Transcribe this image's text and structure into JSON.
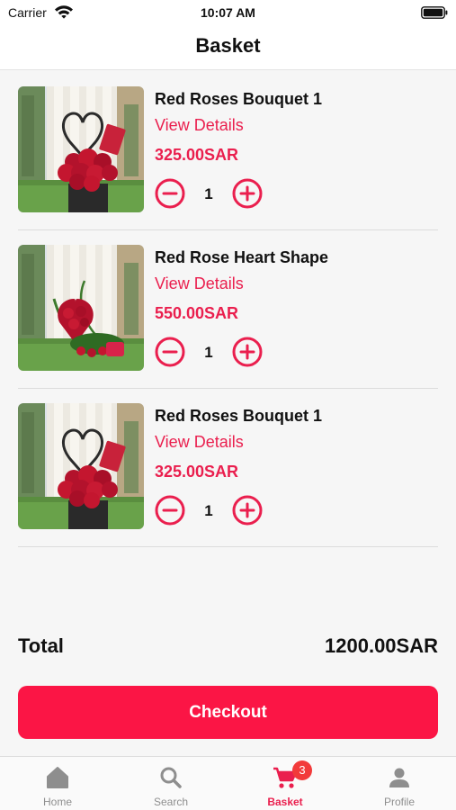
{
  "status_bar": {
    "carrier": "Carrier",
    "time": "10:07 AM"
  },
  "header": {
    "title": "Basket"
  },
  "cart": {
    "items": [
      {
        "name": "Red Roses Bouquet 1",
        "details_label": "View Details",
        "price": "325.00SAR",
        "quantity": "1",
        "image": "bouquet"
      },
      {
        "name": "Red Rose Heart Shape",
        "details_label": "View Details",
        "price": "550.00SAR",
        "quantity": "1",
        "image": "heart"
      },
      {
        "name": "Red Roses Bouquet 1",
        "details_label": "View Details",
        "price": "325.00SAR",
        "quantity": "1",
        "image": "bouquet"
      }
    ]
  },
  "summary": {
    "total_label": "Total",
    "total_value": "1200.00SAR"
  },
  "checkout": {
    "label": "Checkout"
  },
  "tab_bar": {
    "tabs": [
      {
        "label": "Home",
        "icon": "home-icon"
      },
      {
        "label": "Search",
        "icon": "search-icon"
      },
      {
        "label": "Basket",
        "icon": "cart-icon",
        "badge": "3",
        "active": true
      },
      {
        "label": "Profile",
        "icon": "person-icon"
      }
    ]
  },
  "colors": {
    "accent": "#ea1f4e",
    "checkout": "#fb1545",
    "badge": "#f23a3a"
  }
}
